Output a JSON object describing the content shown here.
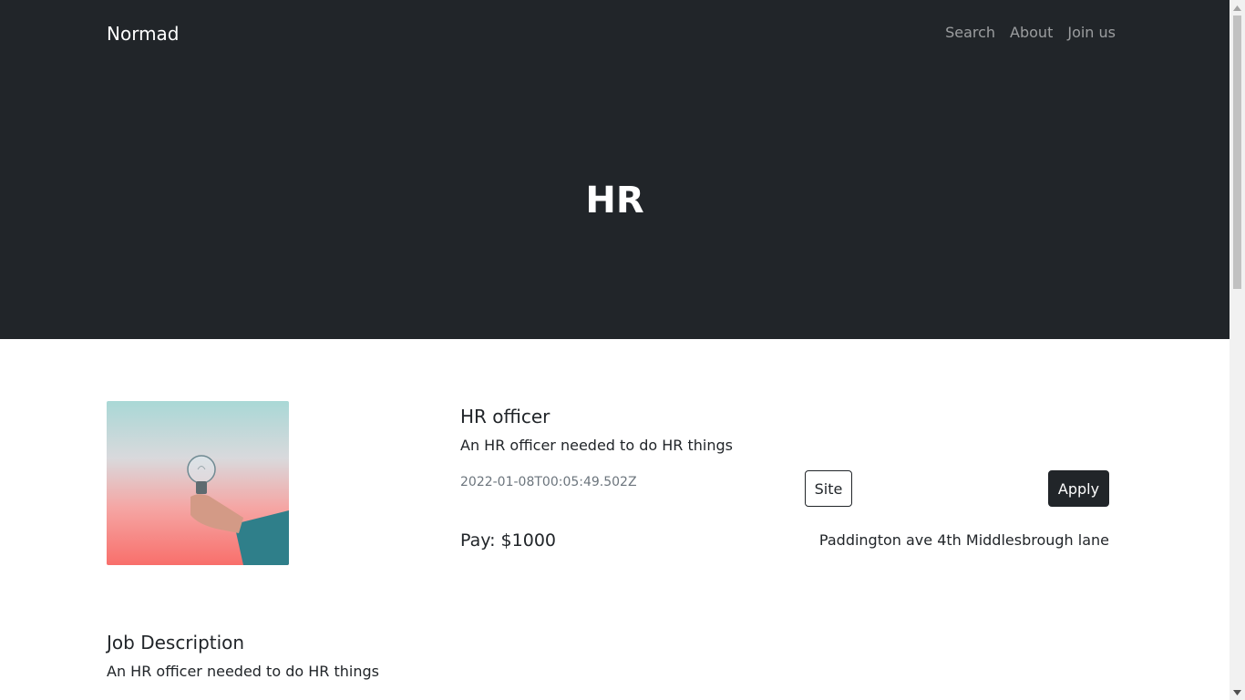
{
  "navbar": {
    "brand": "Normad",
    "links": [
      "Search",
      "About",
      "Join us"
    ]
  },
  "hero": {
    "title": "HR"
  },
  "job": {
    "image_icon": "lightbulb-in-hand-photo",
    "title": "HR officer",
    "summary": "An HR officer needed to do HR things",
    "posted": "2022-01-08T00:05:49.502Z",
    "site_label": "Site",
    "apply_label": "Apply",
    "pay": "Pay: $1000",
    "address": "Paddington ave 4th Middlesbrough lane"
  },
  "description": {
    "heading": "Job Description",
    "text": "An HR officer needed to do HR things"
  },
  "colors": {
    "header_bg": "#212529",
    "primary_button": "#212529",
    "muted_text": "#6c757d"
  }
}
